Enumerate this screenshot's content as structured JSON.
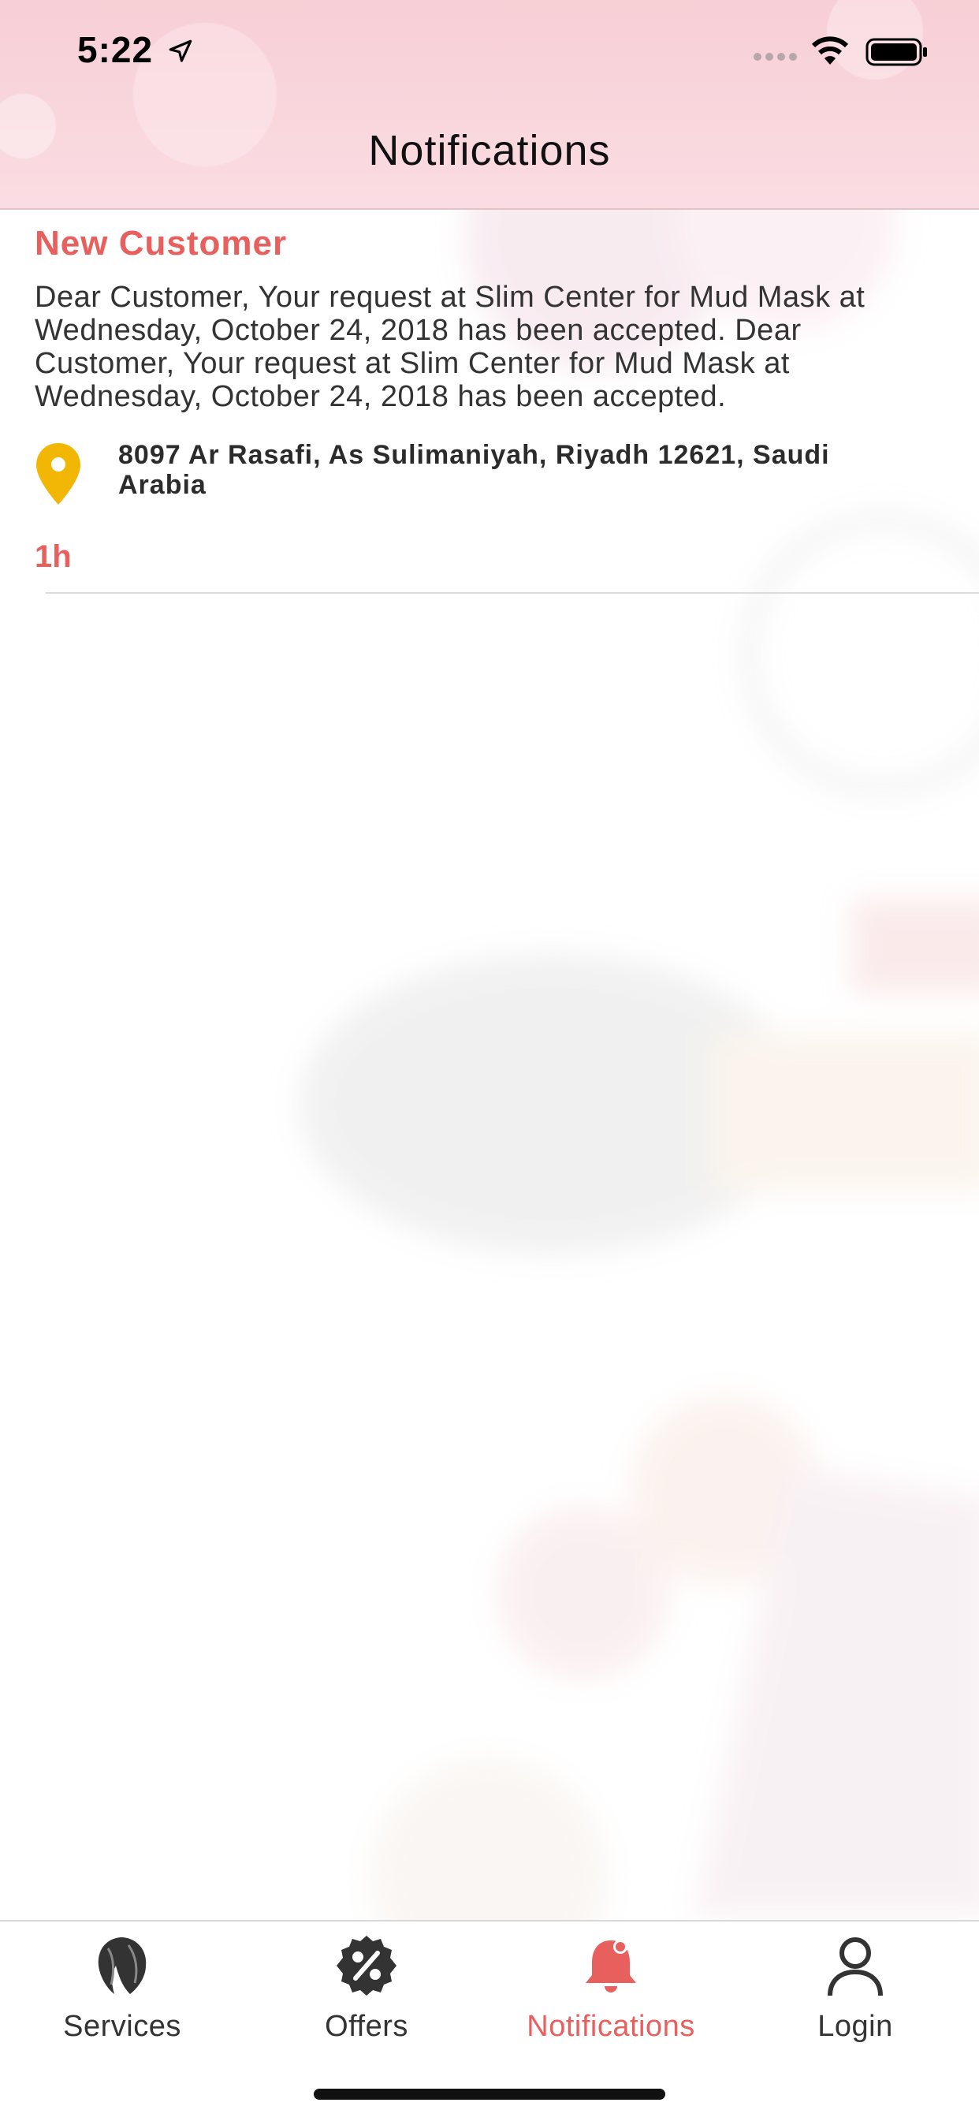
{
  "status_bar": {
    "time": "5:22"
  },
  "header": {
    "title": "Notifications"
  },
  "notification": {
    "title": "New Customer",
    "body": "Dear Customer, Your request at Slim Center for Mud Mask at Wednesday, October 24, 2018 has been accepted. Dear Customer, Your request at Slim Center for Mud Mask at Wednesday, October 24, 2018 has been accepted.",
    "address": "8097 Ar Rasafi, As Sulimaniyah, Riyadh 12621, Saudi Arabia",
    "time_ago": "1h"
  },
  "tabs": [
    {
      "label": "Services",
      "icon": "hair-silhouette-icon",
      "active": false
    },
    {
      "label": "Offers",
      "icon": "percent-badge-icon",
      "active": false
    },
    {
      "label": "Notifications",
      "icon": "bell-icon",
      "active": true
    },
    {
      "label": "Login",
      "icon": "user-icon",
      "active": false
    }
  ],
  "colors": {
    "accent": "#e8605e",
    "pin": "#f2b705",
    "header_bg": "#f8d3d9"
  }
}
